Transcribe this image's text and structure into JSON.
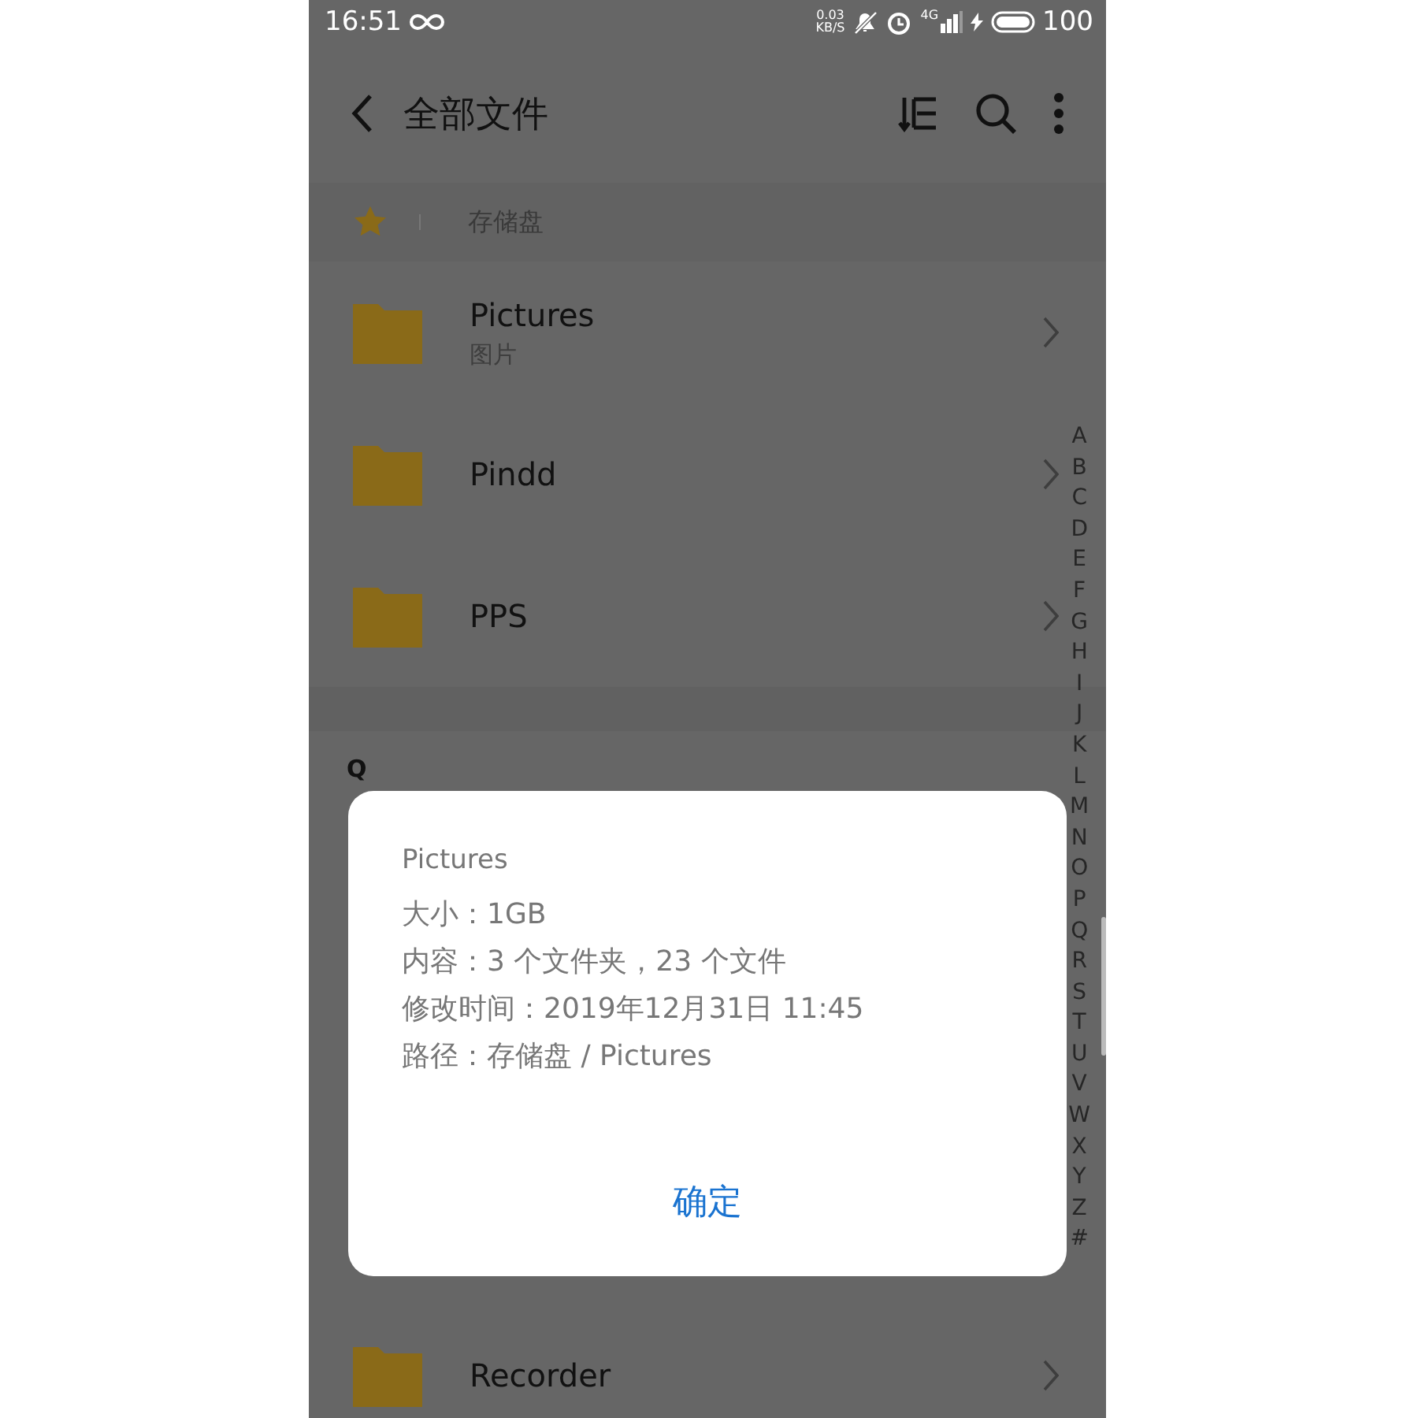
{
  "status_bar": {
    "time": "16:51",
    "speed_value": "0.03",
    "speed_unit": "KB/S",
    "network": "4G",
    "battery": "100"
  },
  "toolbar": {
    "title": "全部文件"
  },
  "breadcrumb": {
    "items": [
      "存储盘"
    ]
  },
  "list": [
    {
      "kind": "folder",
      "name": "Pictures",
      "subtitle": "图片"
    },
    {
      "kind": "folder",
      "name": "Pindd"
    },
    {
      "kind": "folder",
      "name": "PPS"
    },
    {
      "kind": "header",
      "name": "Q"
    },
    {
      "kind": "hidden"
    },
    {
      "kind": "folder",
      "name": "Recorder"
    }
  ],
  "index": [
    "A",
    "B",
    "C",
    "D",
    "E",
    "F",
    "G",
    "H",
    "I",
    "J",
    "K",
    "L",
    "M",
    "N",
    "O",
    "P",
    "Q",
    "R",
    "S",
    "T",
    "U",
    "V",
    "W",
    "X",
    "Y",
    "Z",
    "#"
  ],
  "dialog": {
    "title": "Pictures",
    "lines": [
      "大小：1GB",
      "内容：3 个文件夹，23 个文件",
      "修改时间：2019年12月31日 11:45",
      "路径：存储盘 / Pictures"
    ],
    "button": "确定"
  }
}
